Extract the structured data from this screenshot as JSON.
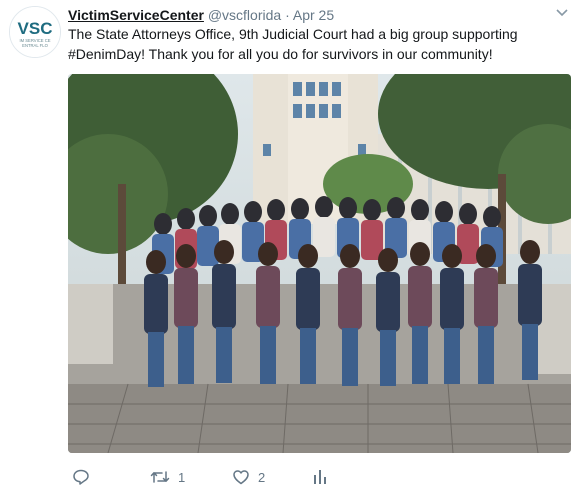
{
  "tweet": {
    "author_name": "VictimServiceCenter",
    "author_handle": "@vscflorida",
    "separator": "·",
    "timestamp": "Apr 25",
    "text_line1": "The State Attorneys Office, 9th Judicial Court had a big group supporting",
    "text_line2": "#DenimDay! Thank you for all you do for survivors in our community!",
    "avatar_logo_text": "VSC",
    "avatar_logo_subtext_1": "IM SERVICE CE",
    "avatar_logo_subtext_2": "ENTRAL FLO",
    "media_icon": "group-photo",
    "accent_color": "#1da1f2",
    "text_muted_color": "#657786"
  },
  "actions": {
    "reply": {
      "icon": "reply-icon",
      "count": ""
    },
    "retweet": {
      "icon": "retweet-icon",
      "count": "1"
    },
    "like": {
      "icon": "heart-icon",
      "count": "2"
    },
    "analytics": {
      "icon": "analytics-icon",
      "count": ""
    }
  },
  "menu": {
    "icon": "chevron-down-icon"
  }
}
